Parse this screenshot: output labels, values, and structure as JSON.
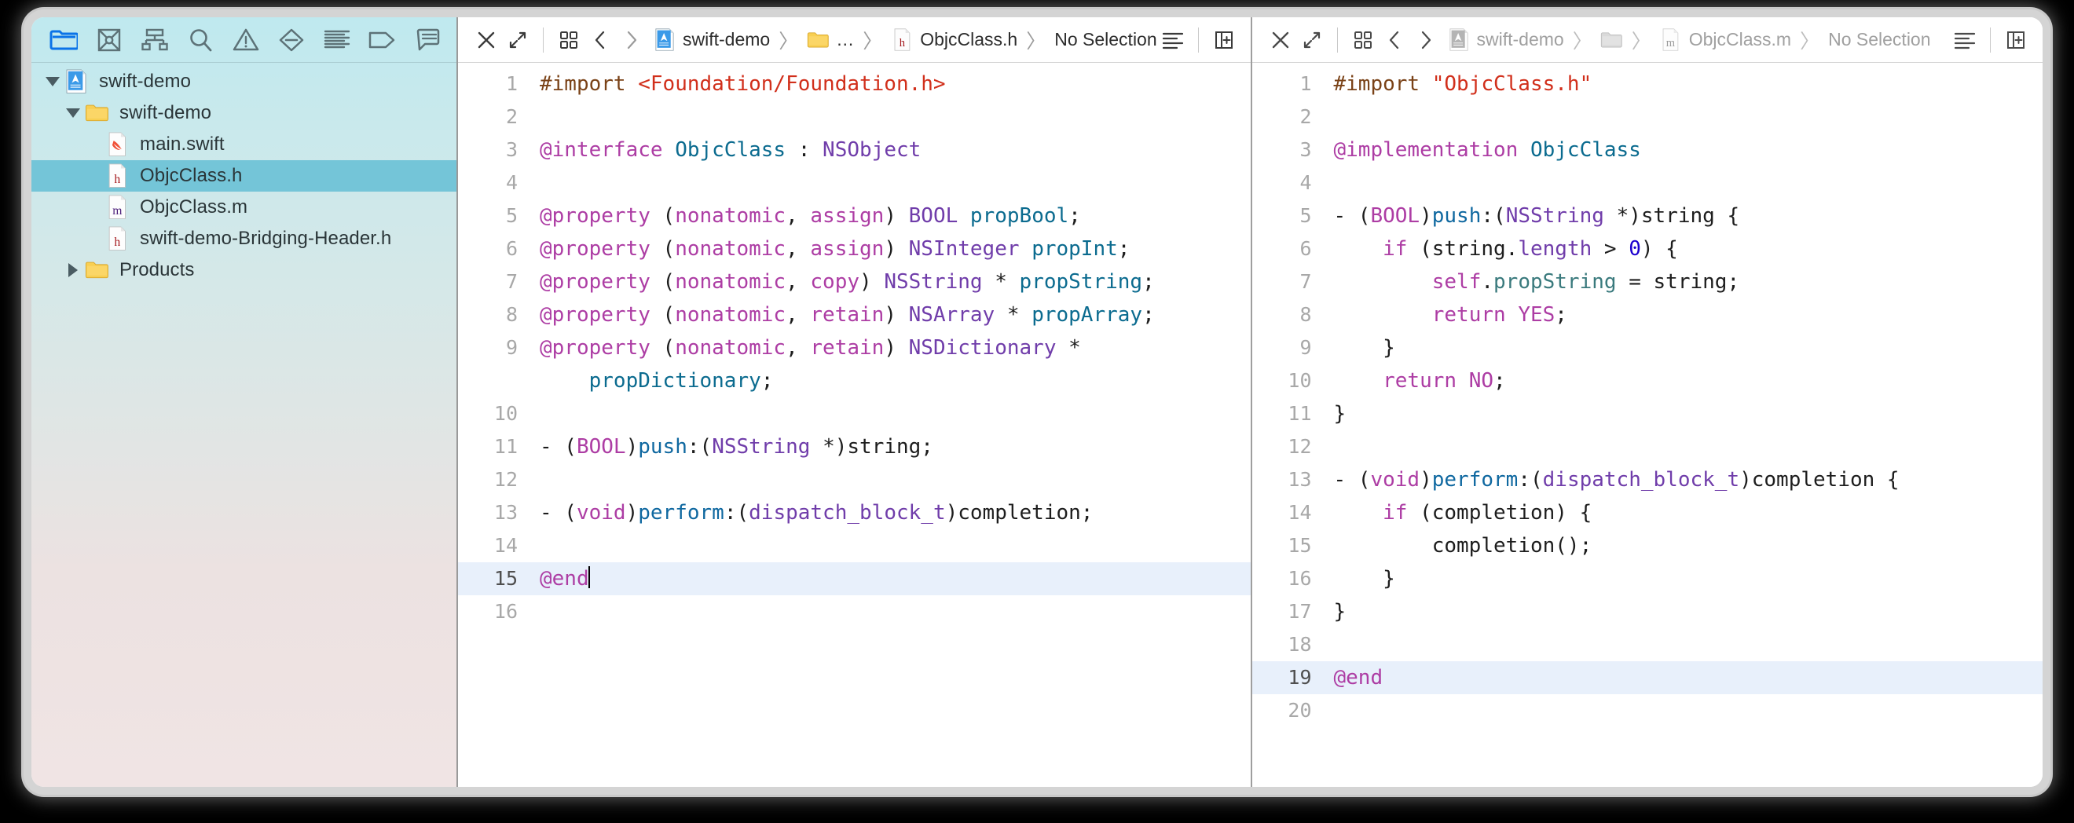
{
  "navigator": {
    "toolbar_icons": [
      {
        "name": "project-navigator-icon",
        "label": "Project navigator",
        "active": true
      },
      {
        "name": "source-control-navigator-icon",
        "label": "Source control navigator",
        "active": false
      },
      {
        "name": "symbol-navigator-icon",
        "label": "Symbol navigator",
        "active": false
      },
      {
        "name": "find-navigator-icon",
        "label": "Find navigator",
        "active": false
      },
      {
        "name": "issue-navigator-icon",
        "label": "Issue navigator",
        "active": false
      },
      {
        "name": "test-navigator-icon",
        "label": "Test navigator",
        "active": false
      },
      {
        "name": "report-navigator-icon",
        "label": "Report navigator",
        "active": false
      },
      {
        "name": "debug-navigator-icon",
        "label": "Debug navigator",
        "active": false
      },
      {
        "name": "breakpoint-navigator-icon",
        "label": "Breakpoint navigator",
        "active": false
      }
    ],
    "tree": [
      {
        "label": "swift-demo",
        "icon": "xcode-project-icon",
        "depth": 0,
        "disclosure": "down",
        "selected": false
      },
      {
        "label": "swift-demo",
        "icon": "folder-icon",
        "depth": 1,
        "disclosure": "down",
        "selected": false
      },
      {
        "label": "main.swift",
        "icon": "swift-file-icon",
        "depth": 2,
        "disclosure": "none",
        "selected": false
      },
      {
        "label": "ObjcClass.h",
        "icon": "header-file-icon",
        "depth": 2,
        "disclosure": "none",
        "selected": true
      },
      {
        "label": "ObjcClass.m",
        "icon": "objc-file-icon",
        "depth": 2,
        "disclosure": "none",
        "selected": false
      },
      {
        "label": "swift-demo-Bridging-Header.h",
        "icon": "header-file-icon",
        "depth": 2,
        "disclosure": "none",
        "selected": false
      },
      {
        "label": "Products",
        "icon": "folder-icon",
        "depth": 1,
        "disclosure": "right",
        "selected": false
      }
    ]
  },
  "left_editor": {
    "active": true,
    "jumpbar": {
      "close_label": "✕",
      "crumbs": [
        {
          "label": "swift-demo",
          "icon": "xcode-project-icon"
        },
        {
          "label": "…",
          "icon": "folder-icon"
        },
        {
          "label": "ObjcClass.h",
          "icon": "header-file-icon"
        },
        {
          "label": "No Selection",
          "icon": "none"
        }
      ]
    },
    "lines": [
      {
        "n": "1",
        "highlight": false,
        "tokens": [
          {
            "t": "#import ",
            "c": "c-pre"
          },
          {
            "t": "<Foundation/Foundation.h>",
            "c": "c-str"
          }
        ]
      },
      {
        "n": "2",
        "highlight": false,
        "tokens": []
      },
      {
        "n": "3",
        "highlight": false,
        "tokens": [
          {
            "t": "@interface ",
            "c": "c-kw"
          },
          {
            "t": "ObjcClass",
            "c": "c-proj"
          },
          {
            "t": " : ",
            "c": "c-plain"
          },
          {
            "t": "NSObject",
            "c": "c-type"
          }
        ]
      },
      {
        "n": "4",
        "highlight": false,
        "tokens": []
      },
      {
        "n": "5",
        "highlight": false,
        "tokens": [
          {
            "t": "@property",
            "c": "c-kw"
          },
          {
            "t": " (",
            "c": "c-plain"
          },
          {
            "t": "nonatomic",
            "c": "c-kw"
          },
          {
            "t": ", ",
            "c": "c-plain"
          },
          {
            "t": "assign",
            "c": "c-kw"
          },
          {
            "t": ") ",
            "c": "c-plain"
          },
          {
            "t": "BOOL",
            "c": "c-type"
          },
          {
            "t": " ",
            "c": "c-plain"
          },
          {
            "t": "propBool",
            "c": "c-proj"
          },
          {
            "t": ";",
            "c": "c-plain"
          }
        ]
      },
      {
        "n": "6",
        "highlight": false,
        "tokens": [
          {
            "t": "@property",
            "c": "c-kw"
          },
          {
            "t": " (",
            "c": "c-plain"
          },
          {
            "t": "nonatomic",
            "c": "c-kw"
          },
          {
            "t": ", ",
            "c": "c-plain"
          },
          {
            "t": "assign",
            "c": "c-kw"
          },
          {
            "t": ") ",
            "c": "c-plain"
          },
          {
            "t": "NSInteger",
            "c": "c-type"
          },
          {
            "t": " ",
            "c": "c-plain"
          },
          {
            "t": "propInt",
            "c": "c-proj"
          },
          {
            "t": ";",
            "c": "c-plain"
          }
        ]
      },
      {
        "n": "7",
        "highlight": false,
        "tokens": [
          {
            "t": "@property",
            "c": "c-kw"
          },
          {
            "t": " (",
            "c": "c-plain"
          },
          {
            "t": "nonatomic",
            "c": "c-kw"
          },
          {
            "t": ", ",
            "c": "c-plain"
          },
          {
            "t": "copy",
            "c": "c-kw"
          },
          {
            "t": ") ",
            "c": "c-plain"
          },
          {
            "t": "NSString",
            "c": "c-type"
          },
          {
            "t": " * ",
            "c": "c-plain"
          },
          {
            "t": "propString",
            "c": "c-proj"
          },
          {
            "t": ";",
            "c": "c-plain"
          }
        ]
      },
      {
        "n": "8",
        "highlight": false,
        "tokens": [
          {
            "t": "@property",
            "c": "c-kw"
          },
          {
            "t": " (",
            "c": "c-plain"
          },
          {
            "t": "nonatomic",
            "c": "c-kw"
          },
          {
            "t": ", ",
            "c": "c-plain"
          },
          {
            "t": "retain",
            "c": "c-kw"
          },
          {
            "t": ") ",
            "c": "c-plain"
          },
          {
            "t": "NSArray",
            "c": "c-type"
          },
          {
            "t": " * ",
            "c": "c-plain"
          },
          {
            "t": "propArray",
            "c": "c-proj"
          },
          {
            "t": ";",
            "c": "c-plain"
          }
        ]
      },
      {
        "n": "9",
        "highlight": false,
        "tokens": [
          {
            "t": "@property",
            "c": "c-kw"
          },
          {
            "t": " (",
            "c": "c-plain"
          },
          {
            "t": "nonatomic",
            "c": "c-kw"
          },
          {
            "t": ", ",
            "c": "c-plain"
          },
          {
            "t": "retain",
            "c": "c-kw"
          },
          {
            "t": ") ",
            "c": "c-plain"
          },
          {
            "t": "NSDictionary",
            "c": "c-type"
          },
          {
            "t": " *",
            "c": "c-plain"
          }
        ]
      },
      {
        "n": "",
        "highlight": false,
        "tokens": [
          {
            "t": "    ",
            "c": "c-plain"
          },
          {
            "t": "propDictionary",
            "c": "c-proj"
          },
          {
            "t": ";",
            "c": "c-plain"
          }
        ]
      },
      {
        "n": "10",
        "highlight": false,
        "tokens": []
      },
      {
        "n": "11",
        "highlight": false,
        "tokens": [
          {
            "t": "- (",
            "c": "c-plain"
          },
          {
            "t": "BOOL",
            "c": "c-kw"
          },
          {
            "t": ")",
            "c": "c-plain"
          },
          {
            "t": "push",
            "c": "c-meth"
          },
          {
            "t": ":(",
            "c": "c-plain"
          },
          {
            "t": "NSString",
            "c": "c-type"
          },
          {
            "t": " *)string;",
            "c": "c-plain"
          }
        ]
      },
      {
        "n": "12",
        "highlight": false,
        "tokens": []
      },
      {
        "n": "13",
        "highlight": false,
        "tokens": [
          {
            "t": "- (",
            "c": "c-plain"
          },
          {
            "t": "void",
            "c": "c-kw"
          },
          {
            "t": ")",
            "c": "c-plain"
          },
          {
            "t": "perform",
            "c": "c-meth"
          },
          {
            "t": ":(",
            "c": "c-plain"
          },
          {
            "t": "dispatch_block_t",
            "c": "c-type"
          },
          {
            "t": ")completion;",
            "c": "c-plain"
          }
        ]
      },
      {
        "n": "14",
        "highlight": false,
        "tokens": []
      },
      {
        "n": "15",
        "highlight": true,
        "caret": true,
        "tokens": [
          {
            "t": "@end",
            "c": "c-kw"
          }
        ]
      },
      {
        "n": "16",
        "highlight": false,
        "tokens": []
      }
    ]
  },
  "right_editor": {
    "active": false,
    "jumpbar": {
      "close_label": "✕",
      "crumbs": [
        {
          "label": "swift-demo",
          "icon": "xcode-project-icon"
        },
        {
          "label": "",
          "icon": "folder-icon"
        },
        {
          "label": "ObjcClass.m",
          "icon": "objc-file-icon"
        },
        {
          "label": "No Selection",
          "icon": "none"
        }
      ]
    },
    "lines": [
      {
        "n": "1",
        "highlight": false,
        "tokens": [
          {
            "t": "#import ",
            "c": "c-pre"
          },
          {
            "t": "\"ObjcClass.h\"",
            "c": "c-str"
          }
        ]
      },
      {
        "n": "2",
        "highlight": false,
        "tokens": []
      },
      {
        "n": "3",
        "highlight": false,
        "tokens": [
          {
            "t": "@implementation ",
            "c": "c-kw"
          },
          {
            "t": "ObjcClass",
            "c": "c-proj"
          }
        ]
      },
      {
        "n": "4",
        "highlight": false,
        "tokens": []
      },
      {
        "n": "5",
        "highlight": false,
        "tokens": [
          {
            "t": "- (",
            "c": "c-plain"
          },
          {
            "t": "BOOL",
            "c": "c-kw"
          },
          {
            "t": ")",
            "c": "c-plain"
          },
          {
            "t": "push",
            "c": "c-meth"
          },
          {
            "t": ":(",
            "c": "c-plain"
          },
          {
            "t": "NSString",
            "c": "c-type"
          },
          {
            "t": " *)string {",
            "c": "c-plain"
          }
        ]
      },
      {
        "n": "6",
        "highlight": false,
        "tokens": [
          {
            "t": "    ",
            "c": "c-plain"
          },
          {
            "t": "if",
            "c": "c-kw"
          },
          {
            "t": " (string.",
            "c": "c-plain"
          },
          {
            "t": "length",
            "c": "c-type"
          },
          {
            "t": " > ",
            "c": "c-plain"
          },
          {
            "t": "0",
            "c": "c-num"
          },
          {
            "t": ") {",
            "c": "c-plain"
          }
        ]
      },
      {
        "n": "7",
        "highlight": false,
        "tokens": [
          {
            "t": "        ",
            "c": "c-plain"
          },
          {
            "t": "self",
            "c": "c-kw"
          },
          {
            "t": ".",
            "c": "c-plain"
          },
          {
            "t": "propString",
            "c": "c-prop"
          },
          {
            "t": " = string;",
            "c": "c-plain"
          }
        ]
      },
      {
        "n": "8",
        "highlight": false,
        "tokens": [
          {
            "t": "        ",
            "c": "c-plain"
          },
          {
            "t": "return",
            "c": "c-kw"
          },
          {
            "t": " ",
            "c": "c-plain"
          },
          {
            "t": "YES",
            "c": "c-kw"
          },
          {
            "t": ";",
            "c": "c-plain"
          }
        ]
      },
      {
        "n": "9",
        "highlight": false,
        "tokens": [
          {
            "t": "    }",
            "c": "c-plain"
          }
        ]
      },
      {
        "n": "10",
        "highlight": false,
        "tokens": [
          {
            "t": "    ",
            "c": "c-plain"
          },
          {
            "t": "return",
            "c": "c-kw"
          },
          {
            "t": " ",
            "c": "c-plain"
          },
          {
            "t": "NO",
            "c": "c-kw"
          },
          {
            "t": ";",
            "c": "c-plain"
          }
        ]
      },
      {
        "n": "11",
        "highlight": false,
        "tokens": [
          {
            "t": "}",
            "c": "c-plain"
          }
        ]
      },
      {
        "n": "12",
        "highlight": false,
        "tokens": []
      },
      {
        "n": "13",
        "highlight": false,
        "tokens": [
          {
            "t": "- (",
            "c": "c-plain"
          },
          {
            "t": "void",
            "c": "c-kw"
          },
          {
            "t": ")",
            "c": "c-plain"
          },
          {
            "t": "perform",
            "c": "c-meth"
          },
          {
            "t": ":(",
            "c": "c-plain"
          },
          {
            "t": "dispatch_block_t",
            "c": "c-type"
          },
          {
            "t": ")completion {",
            "c": "c-plain"
          }
        ]
      },
      {
        "n": "14",
        "highlight": false,
        "tokens": [
          {
            "t": "    ",
            "c": "c-plain"
          },
          {
            "t": "if",
            "c": "c-kw"
          },
          {
            "t": " (completion) {",
            "c": "c-plain"
          }
        ]
      },
      {
        "n": "15",
        "highlight": false,
        "tokens": [
          {
            "t": "        completion();",
            "c": "c-plain"
          }
        ]
      },
      {
        "n": "16",
        "highlight": false,
        "tokens": [
          {
            "t": "    }",
            "c": "c-plain"
          }
        ]
      },
      {
        "n": "17",
        "highlight": false,
        "tokens": [
          {
            "t": "}",
            "c": "c-plain"
          }
        ]
      },
      {
        "n": "18",
        "highlight": false,
        "tokens": []
      },
      {
        "n": "19",
        "highlight": true,
        "tokens": [
          {
            "t": "@end",
            "c": "c-kw"
          }
        ]
      },
      {
        "n": "20",
        "highlight": false,
        "tokens": []
      }
    ]
  },
  "colors": {
    "selection_blue": "#74c5d8",
    "active_line": "#e8f0fb",
    "accent_blue": "#0a73e8",
    "keyword": "#ad3da4",
    "string": "#d12f1b",
    "type": "#703daa",
    "project_type": "#0b6b8f",
    "preprocessor": "#7a4217",
    "number": "#1c00cf"
  }
}
